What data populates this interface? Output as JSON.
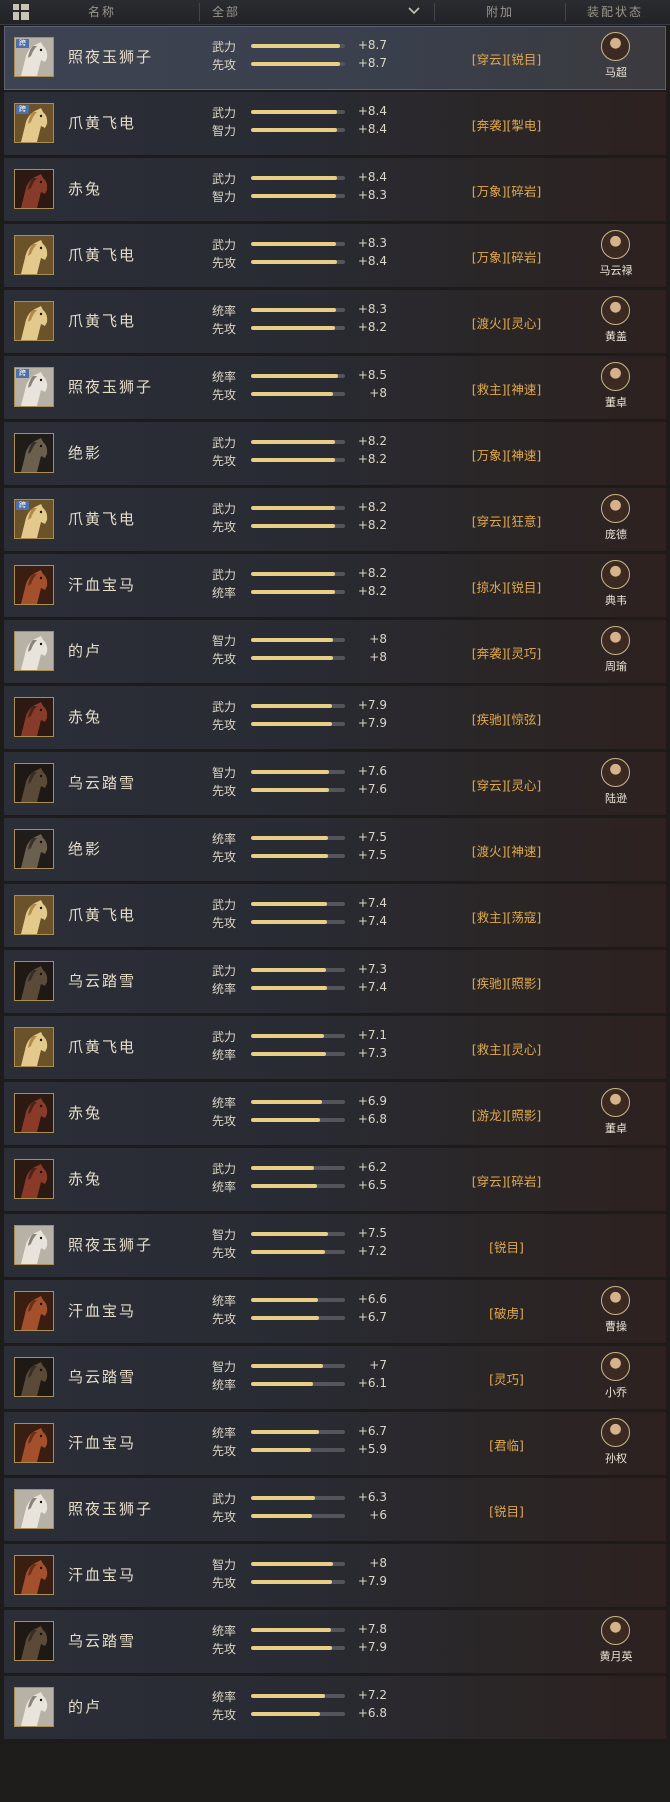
{
  "header": {
    "col_name": "名称",
    "filter_value": "全部",
    "col_extra": "附加",
    "col_status": "装配状态"
  },
  "colors": {
    "bar_fill": "#e9cf86",
    "extra_text": "#e1a94c",
    "background": "#1d1c1b"
  },
  "rows": [
    {
      "name": "照夜玉狮子",
      "horse": "white",
      "tag": "跨",
      "selected": true,
      "attrs": [
        {
          "label": "武力",
          "value": "+8.7"
        },
        {
          "label": "先攻",
          "value": "+8.7"
        }
      ],
      "extra": "[穿云][锐目]",
      "hero": "马超"
    },
    {
      "name": "爪黄飞电",
      "horse": "gold",
      "tag": "跨",
      "attrs": [
        {
          "label": "武力",
          "value": "+8.4"
        },
        {
          "label": "智力",
          "value": "+8.4"
        }
      ],
      "extra": "[奔袭][掣电]",
      "hero": ""
    },
    {
      "name": "赤兔",
      "horse": "red",
      "tag": "",
      "attrs": [
        {
          "label": "武力",
          "value": "+8.4"
        },
        {
          "label": "智力",
          "value": "+8.3"
        }
      ],
      "extra": "[万象][碎岩]",
      "hero": ""
    },
    {
      "name": "爪黄飞电",
      "horse": "gold",
      "tag": "",
      "attrs": [
        {
          "label": "武力",
          "value": "+8.3"
        },
        {
          "label": "先攻",
          "value": "+8.4"
        }
      ],
      "extra": "[万象][碎岩]",
      "hero": "马云禄"
    },
    {
      "name": "爪黄飞电",
      "horse": "gold",
      "tag": "",
      "attrs": [
        {
          "label": "统率",
          "value": "+8.3"
        },
        {
          "label": "先攻",
          "value": "+8.2"
        }
      ],
      "extra": "[渡火][灵心]",
      "hero": "黄盖"
    },
    {
      "name": "照夜玉狮子",
      "horse": "white",
      "tag": "跨",
      "attrs": [
        {
          "label": "统率",
          "value": "+8.5"
        },
        {
          "label": "先攻",
          "value": "+8"
        }
      ],
      "extra": "[救主][神速]",
      "hero": "董卓"
    },
    {
      "name": "绝影",
      "horse": "black",
      "tag": "",
      "attrs": [
        {
          "label": "武力",
          "value": "+8.2"
        },
        {
          "label": "先攻",
          "value": "+8.2"
        }
      ],
      "extra": "[万象][神速]",
      "hero": ""
    },
    {
      "name": "爪黄飞电",
      "horse": "gold",
      "tag": "跨",
      "attrs": [
        {
          "label": "武力",
          "value": "+8.2"
        },
        {
          "label": "先攻",
          "value": "+8.2"
        }
      ],
      "extra": "[穿云][狂意]",
      "hero": "庞德"
    },
    {
      "name": "汗血宝马",
      "horse": "bay",
      "tag": "",
      "attrs": [
        {
          "label": "武力",
          "value": "+8.2"
        },
        {
          "label": "统率",
          "value": "+8.2"
        }
      ],
      "extra": "[掠水][锐目]",
      "hero": "典韦"
    },
    {
      "name": "的卢",
      "horse": "white",
      "tag": "",
      "attrs": [
        {
          "label": "智力",
          "value": "+8"
        },
        {
          "label": "先攻",
          "value": "+8"
        }
      ],
      "extra": "[奔袭][灵巧]",
      "hero": "周瑜"
    },
    {
      "name": "赤兔",
      "horse": "red",
      "tag": "",
      "attrs": [
        {
          "label": "武力",
          "value": "+7.9"
        },
        {
          "label": "先攻",
          "value": "+7.9"
        }
      ],
      "extra": "[疾驰][惊弦]",
      "hero": ""
    },
    {
      "name": "乌云踏雪",
      "horse": "dark",
      "tag": "",
      "attrs": [
        {
          "label": "智力",
          "value": "+7.6"
        },
        {
          "label": "先攻",
          "value": "+7.6"
        }
      ],
      "extra": "[穿云][灵心]",
      "hero": "陆逊"
    },
    {
      "name": "绝影",
      "horse": "black",
      "tag": "",
      "attrs": [
        {
          "label": "统率",
          "value": "+7.5"
        },
        {
          "label": "先攻",
          "value": "+7.5"
        }
      ],
      "extra": "[渡火][神速]",
      "hero": ""
    },
    {
      "name": "爪黄飞电",
      "horse": "gold",
      "tag": "",
      "attrs": [
        {
          "label": "武力",
          "value": "+7.4"
        },
        {
          "label": "先攻",
          "value": "+7.4"
        }
      ],
      "extra": "[救主][荡寇]",
      "hero": ""
    },
    {
      "name": "乌云踏雪",
      "horse": "dark",
      "tag": "",
      "attrs": [
        {
          "label": "武力",
          "value": "+7.3"
        },
        {
          "label": "统率",
          "value": "+7.4"
        }
      ],
      "extra": "[疾驰][照影]",
      "hero": ""
    },
    {
      "name": "爪黄飞电",
      "horse": "gold",
      "tag": "",
      "attrs": [
        {
          "label": "武力",
          "value": "+7.1"
        },
        {
          "label": "统率",
          "value": "+7.3"
        }
      ],
      "extra": "[救主][灵心]",
      "hero": ""
    },
    {
      "name": "赤兔",
      "horse": "red",
      "tag": "",
      "attrs": [
        {
          "label": "统率",
          "value": "+6.9"
        },
        {
          "label": "先攻",
          "value": "+6.8"
        }
      ],
      "extra": "[游龙][照影]",
      "hero": "董卓"
    },
    {
      "name": "赤兔",
      "horse": "red",
      "tag": "",
      "attrs": [
        {
          "label": "武力",
          "value": "+6.2"
        },
        {
          "label": "统率",
          "value": "+6.5"
        }
      ],
      "extra": "[穿云][碎岩]",
      "hero": ""
    },
    {
      "name": "照夜玉狮子",
      "horse": "white",
      "tag": "",
      "attrs": [
        {
          "label": "智力",
          "value": "+7.5"
        },
        {
          "label": "先攻",
          "value": "+7.2"
        }
      ],
      "extra": "[锐目]",
      "hero": ""
    },
    {
      "name": "汗血宝马",
      "horse": "bay",
      "tag": "",
      "attrs": [
        {
          "label": "统率",
          "value": "+6.6"
        },
        {
          "label": "先攻",
          "value": "+6.7"
        }
      ],
      "extra": "[破虏]",
      "hero": "曹操"
    },
    {
      "name": "乌云踏雪",
      "horse": "dark",
      "tag": "",
      "attrs": [
        {
          "label": "智力",
          "value": "+7"
        },
        {
          "label": "统率",
          "value": "+6.1"
        }
      ],
      "extra": "[灵巧]",
      "hero": "小乔"
    },
    {
      "name": "汗血宝马",
      "horse": "bay",
      "tag": "",
      "attrs": [
        {
          "label": "统率",
          "value": "+6.7"
        },
        {
          "label": "先攻",
          "value": "+5.9"
        }
      ],
      "extra": "[君临]",
      "hero": "孙权"
    },
    {
      "name": "照夜玉狮子",
      "horse": "white",
      "tag": "",
      "attrs": [
        {
          "label": "武力",
          "value": "+6.3"
        },
        {
          "label": "先攻",
          "value": "+6"
        }
      ],
      "extra": "[锐目]",
      "hero": ""
    },
    {
      "name": "汗血宝马",
      "horse": "bay",
      "tag": "",
      "attrs": [
        {
          "label": "智力",
          "value": "+8"
        },
        {
          "label": "先攻",
          "value": "+7.9"
        }
      ],
      "extra": "",
      "hero": ""
    },
    {
      "name": "乌云踏雪",
      "horse": "dark",
      "tag": "",
      "attrs": [
        {
          "label": "统率",
          "value": "+7.8"
        },
        {
          "label": "先攻",
          "value": "+7.9"
        }
      ],
      "extra": "",
      "hero": "黄月英"
    },
    {
      "name": "的卢",
      "horse": "white",
      "tag": "",
      "attrs": [
        {
          "label": "统率",
          "value": "+7.2"
        },
        {
          "label": "先攻",
          "value": "+6.8"
        }
      ],
      "extra": "",
      "hero": ""
    }
  ]
}
